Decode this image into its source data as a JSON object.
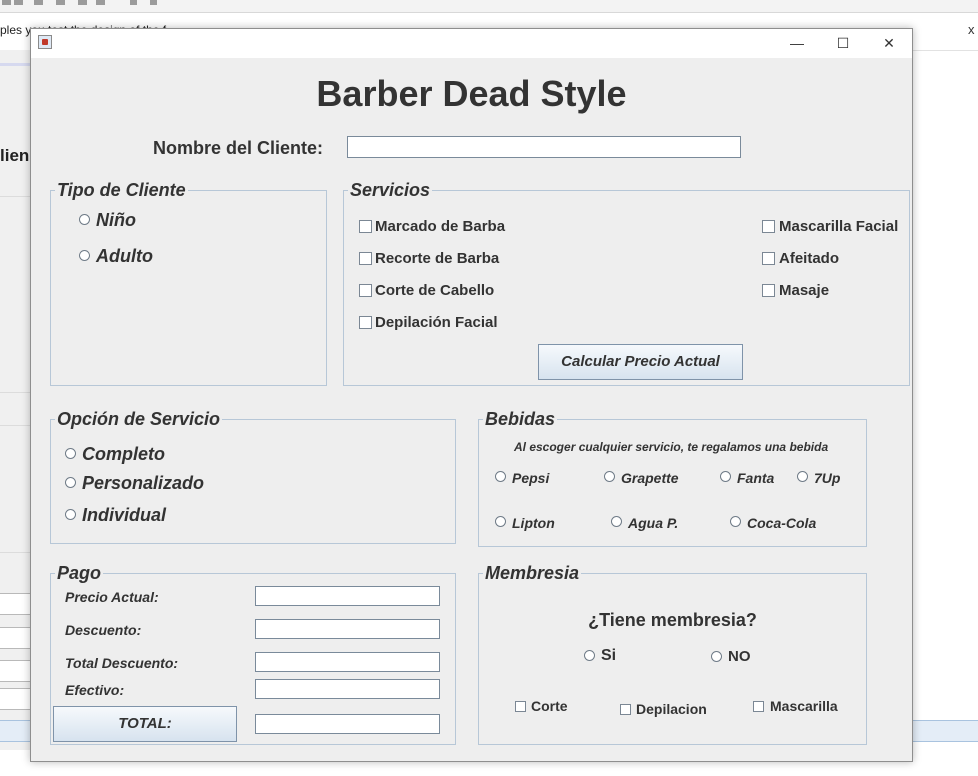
{
  "background": {
    "tab_text": "ples you test the design of the f",
    "tab_close": "x",
    "sidebar_label": "lien"
  },
  "window": {
    "app_icon": "java-cup-icon",
    "minimize": "—",
    "maximize": "☐",
    "close": "✕"
  },
  "header": {
    "title": "Barber Dead Style",
    "client_label": "Nombre del Cliente:",
    "client_value": ""
  },
  "tipo_cliente": {
    "legend": "Tipo de Cliente",
    "options": [
      "Niño",
      "Adulto"
    ]
  },
  "servicios": {
    "legend": "Servicios",
    "left": [
      "Marcado de Barba",
      "Recorte de Barba",
      "Corte de Cabello",
      "Depilación Facial"
    ],
    "right": [
      "Mascarilla Facial",
      "Afeitado",
      "Masaje"
    ],
    "button": "Calcular Precio Actual"
  },
  "opcion_servicio": {
    "legend": "Opción de Servicio",
    "options": [
      "Completo",
      "Personalizado",
      "Individual"
    ]
  },
  "bebidas": {
    "legend": "Bebidas",
    "note": "Al escoger cualquier servicio, te regalamos una bebida",
    "options": [
      "Pepsi",
      "Grapette",
      "Fanta",
      "7Up",
      "Lipton",
      "Agua P.",
      "Coca-Cola"
    ]
  },
  "pago": {
    "legend": "Pago",
    "precio_label": "Precio Actual:",
    "descuento_label": "Descuento:",
    "total_descuento_label": "Total Descuento:",
    "efectivo_label": "Efectivo:",
    "total_button": "TOTAL:"
  },
  "membresia": {
    "legend": "Membresia",
    "question": "¿Tiene membresia?",
    "yes": "Si",
    "no": "NO",
    "extras": [
      "Corte",
      "Depilacion",
      "Mascarilla"
    ]
  }
}
